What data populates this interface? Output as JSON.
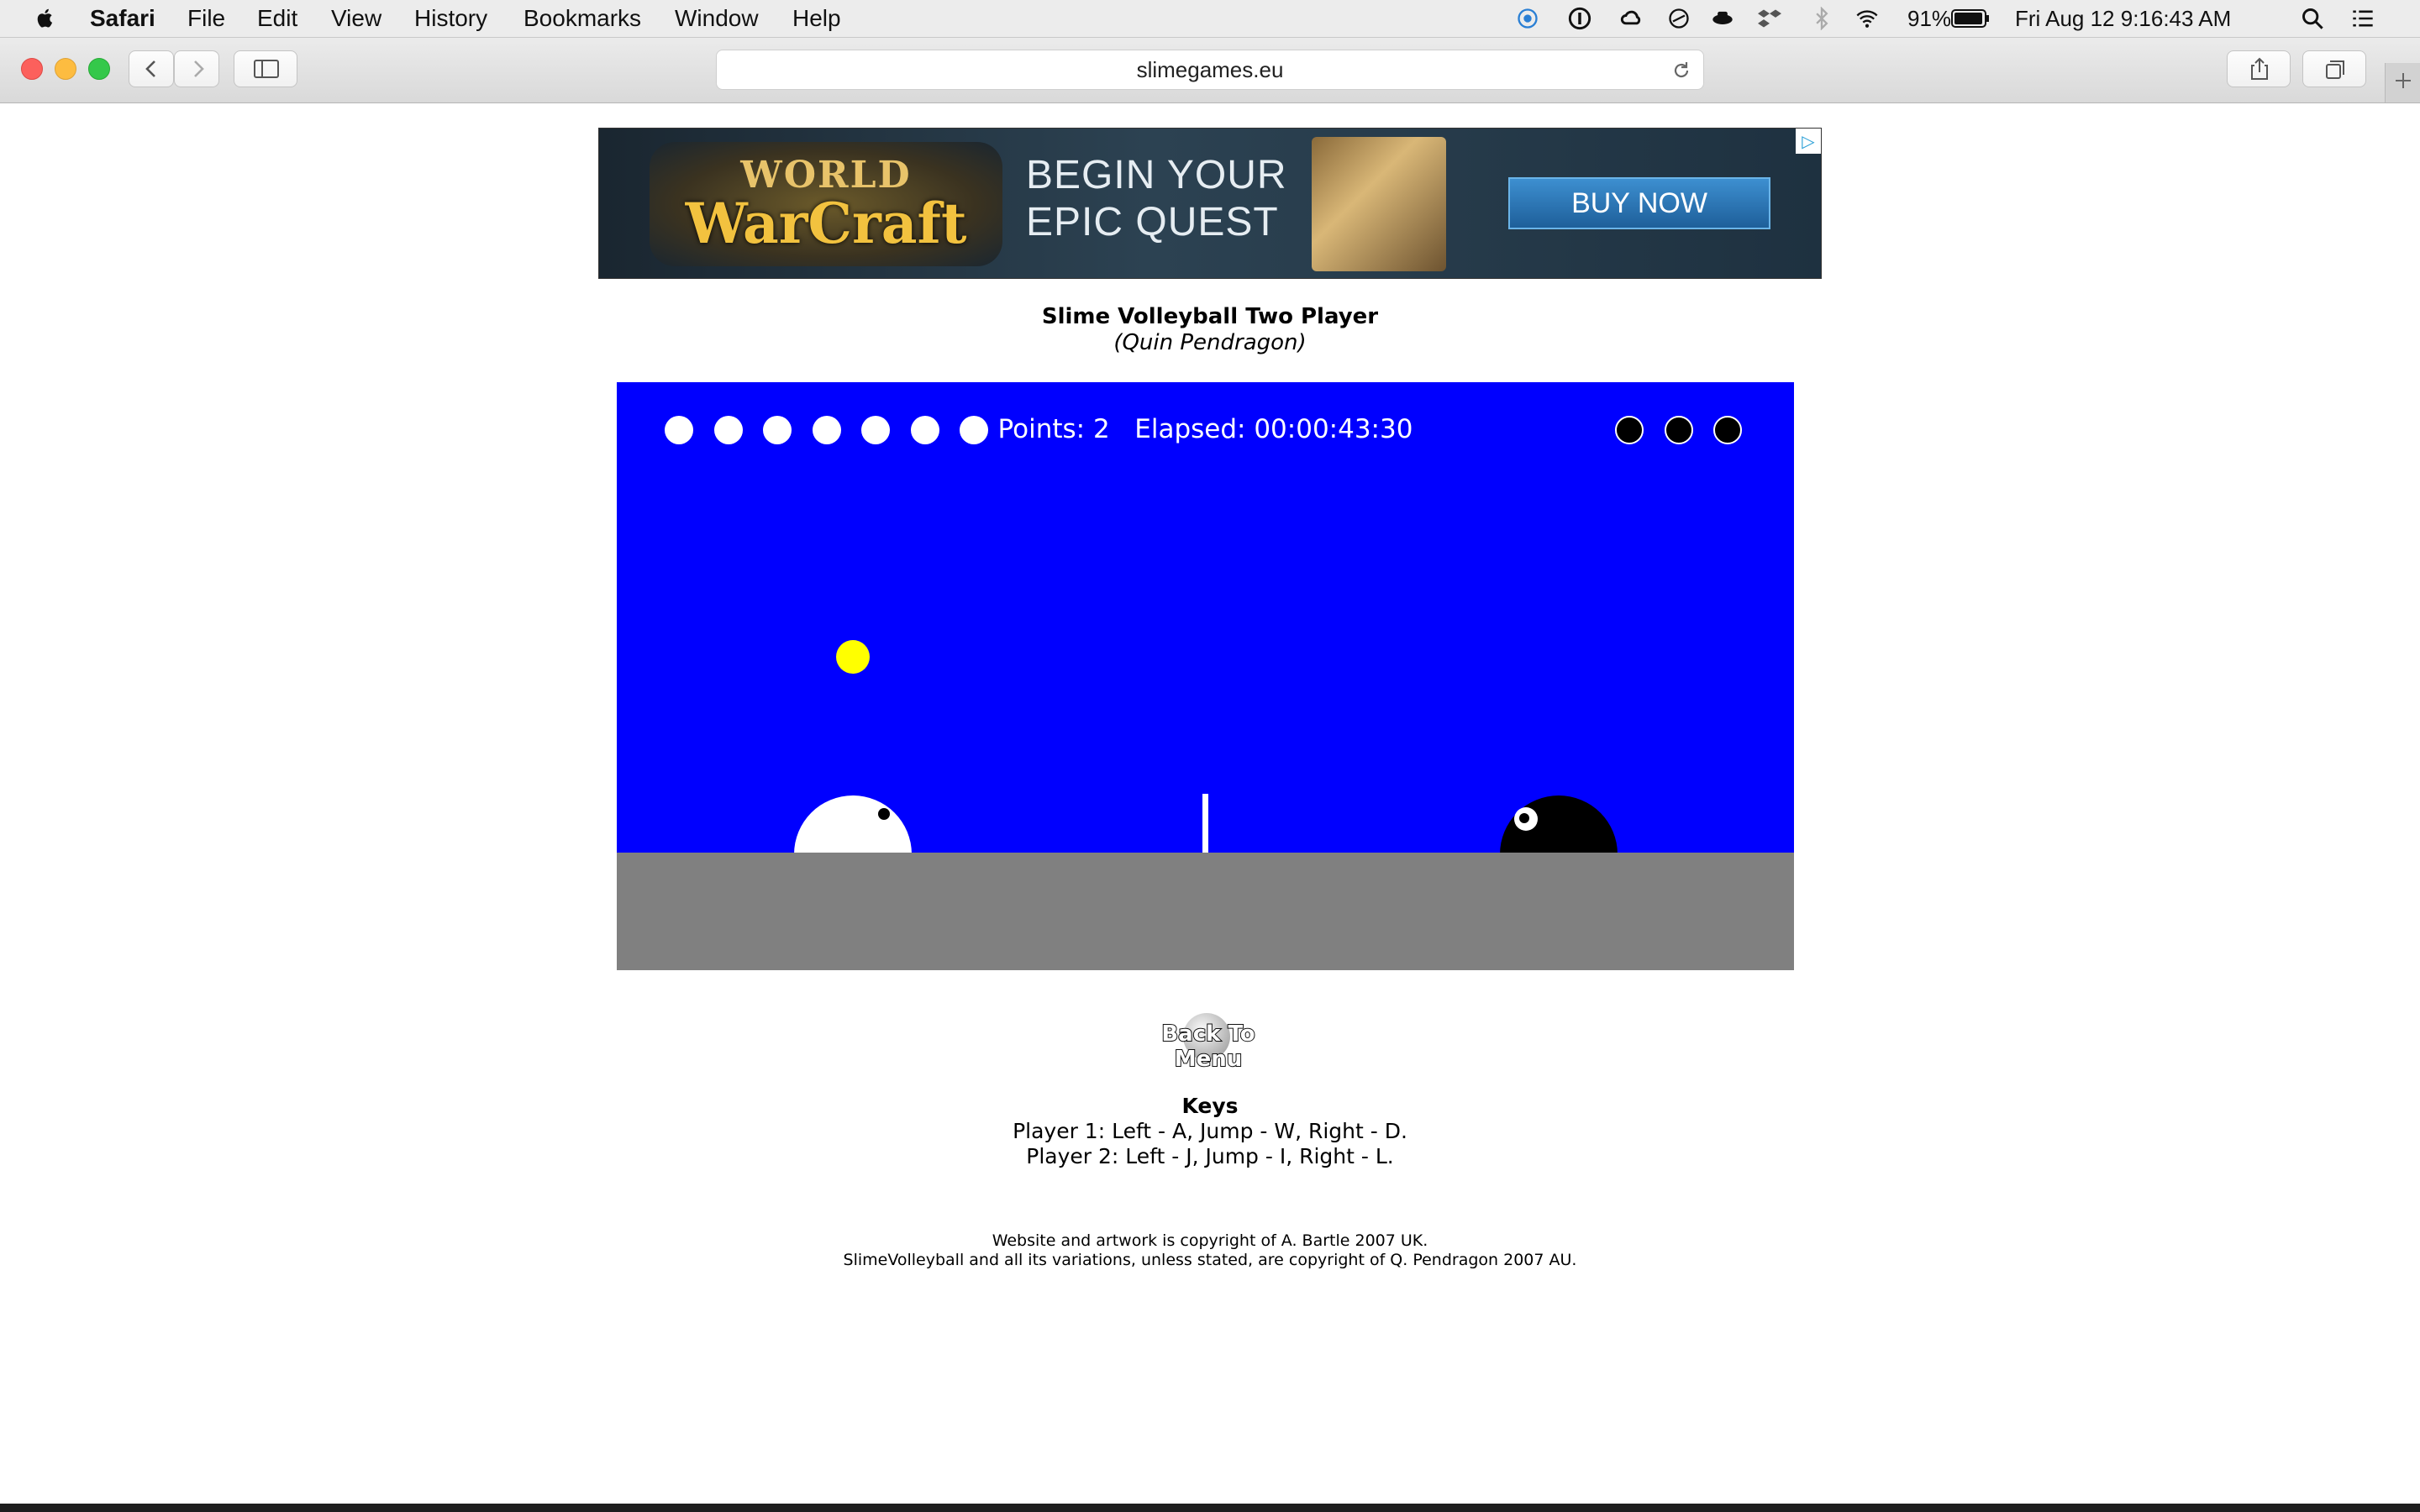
{
  "menubar": {
    "app_name": "Safari",
    "items": [
      "File",
      "Edit",
      "View",
      "History",
      "Bookmarks",
      "Window",
      "Help"
    ],
    "battery": "91%",
    "datetime": "Fri Aug 12  9:16:43 AM"
  },
  "browser": {
    "url": "slimegames.eu"
  },
  "ad": {
    "logo_top": "WORLD",
    "logo_main": "WarCraft",
    "headline_1": "BEGIN YOUR",
    "headline_2": "EPIC QUEST",
    "cta": "BUY NOW"
  },
  "page": {
    "title": "Slime Volleyball Two Player",
    "author": "(Quin Pendragon)"
  },
  "game": {
    "hud_text": "Points: 2   Elapsed: 00:00:43:30",
    "player1_balls": 7,
    "player2_balls": 3,
    "colors": {
      "sky": "#0000ff",
      "ground": "#808080",
      "ball": "#ffff00",
      "player1": "#ffffff",
      "player2": "#000000"
    }
  },
  "menu_button": {
    "label": "Back To Menu"
  },
  "keys": {
    "heading": "Keys",
    "player1": "Player 1: Left - A, Jump - W, Right - D.",
    "player2": "Player 2: Left - J, Jump - I, Right - L."
  },
  "footer": {
    "line1": "Website and artwork is copyright of A. Bartle 2007 UK.",
    "line2": "SlimeVolleyball and all its variations, unless stated, are copyright of Q. Pendragon 2007 AU."
  }
}
